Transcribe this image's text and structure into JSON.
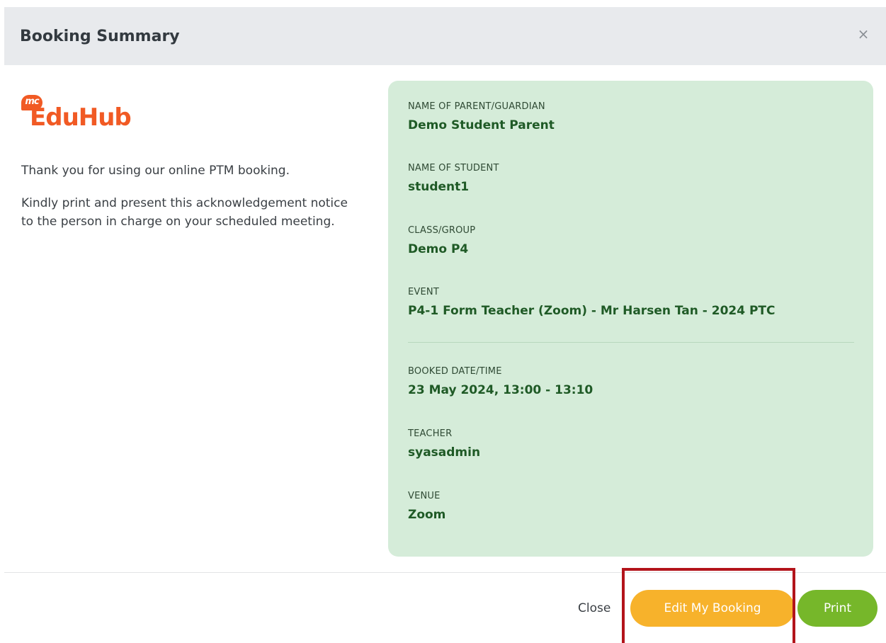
{
  "header": {
    "title": "Booking Summary",
    "close_icon": "×"
  },
  "logo": {
    "badge": "mc",
    "word": "EduHub"
  },
  "intro": {
    "line1": "Thank you for using our online PTM booking.",
    "line2": "Kindly print and present this acknowledgement notice to the person in charge on your scheduled meeting."
  },
  "details": {
    "parent_label": "NAME OF PARENT/GUARDIAN",
    "parent_value": "Demo Student Parent",
    "student_label": "NAME OF STUDENT",
    "student_value": "student1",
    "class_label": "CLASS/GROUP",
    "class_value": "Demo P4",
    "event_label": "EVENT",
    "event_value": "P4-1 Form Teacher (Zoom) - Mr Harsen Tan - 2024 PTC",
    "datetime_label": "BOOKED DATE/TIME",
    "datetime_value": "23 May 2024, 13:00 - 13:10",
    "teacher_label": "TEACHER",
    "teacher_value": "syasadmin",
    "venue_label": "VENUE",
    "venue_value": "Zoom"
  },
  "footer": {
    "close_label": "Close",
    "edit_label": "Edit My Booking",
    "print_label": "Print"
  },
  "colors": {
    "brand_orange": "#f15a24",
    "panel_green": "#d5ecd9",
    "value_green": "#1f5a26",
    "edit_button": "#f7b22b",
    "print_button": "#76b72a",
    "highlight": "#b3141b"
  }
}
